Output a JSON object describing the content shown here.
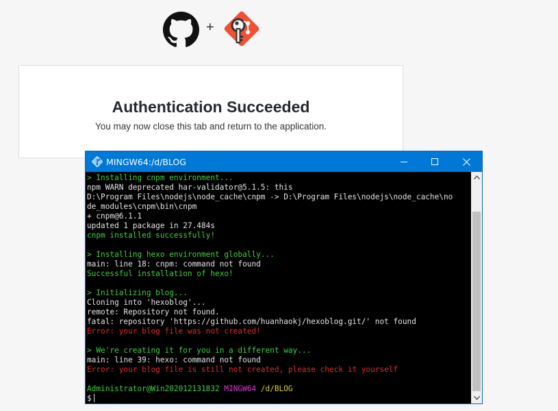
{
  "header": {
    "plus": "+",
    "github_logo_icon": "github-octocat-icon",
    "git_credential_manager_icon": "git-credential-manager-icon"
  },
  "auth": {
    "title": "Authentication Succeeded",
    "message": "You may now close this tab and return to the application."
  },
  "terminal": {
    "title": "MINGW64:/d/BLOG",
    "app_icon": "git-bash-icon",
    "controls": [
      "minimize-icon",
      "maximize-icon",
      "close-icon"
    ],
    "lines": [
      [
        {
          "t": "> Installing cnpm environment...",
          "c": "g"
        }
      ],
      [
        {
          "t": "npm WARN deprecated har-validator@5.1.5: this",
          "c": "w"
        }
      ],
      [
        {
          "t": "D:\\Program Files\\nodejs\\node_cache\\cnpm -> D:\\Program Files\\nodejs\\node_cache\\no",
          "c": "w"
        }
      ],
      [
        {
          "t": "de_modules\\cnpm\\bin\\cnpm",
          "c": "w"
        }
      ],
      [
        {
          "t": "+ cnpm@6.1.1",
          "c": "w"
        }
      ],
      [
        {
          "t": "updated 1 package in 27.484s",
          "c": "w"
        }
      ],
      [
        {
          "t": "cnpm installed successfully!",
          "c": "g"
        }
      ],
      [],
      [
        {
          "t": "> Installing hexo environment globally...",
          "c": "g"
        }
      ],
      [
        {
          "t": "main: line 18: cnpm: command not found",
          "c": "w"
        }
      ],
      [
        {
          "t": "Successful installation of hexo!",
          "c": "g"
        }
      ],
      [],
      [
        {
          "t": "> Initializing blog...",
          "c": "g"
        }
      ],
      [
        {
          "t": "Cloning into 'hexoblog'...",
          "c": "w"
        }
      ],
      [
        {
          "t": "remote: Repository not found.",
          "c": "w"
        }
      ],
      [
        {
          "t": "fatal: repository 'https://github.com/huanhaokj/hexoblog.git/' not found",
          "c": "w"
        }
      ],
      [
        {
          "t": "Error: your blog file was not created!",
          "c": "r"
        }
      ],
      [],
      [
        {
          "t": "> We're creating it for you in a different way...",
          "c": "g"
        }
      ],
      [
        {
          "t": "main: line 39: hexo: command not found",
          "c": "w"
        }
      ],
      [
        {
          "t": "Error: your blog file is still not created, please check it yourself",
          "c": "r"
        }
      ],
      [],
      [
        {
          "t": "Administrator@Win202012131832",
          "c": "g"
        },
        {
          "t": " ",
          "c": "w"
        },
        {
          "t": "MINGW64",
          "c": "m"
        },
        {
          "t": " ",
          "c": "w"
        },
        {
          "t": "/d/BLOG",
          "c": "y"
        }
      ],
      [
        {
          "t": "$",
          "c": "w"
        }
      ]
    ]
  },
  "colors": {
    "titlebar": "#0078d7",
    "console_bg": "#000000",
    "green": "#3fd13f",
    "red": "#e22a2a",
    "magenta": "#d63bd6",
    "yellow": "#d8d42a"
  }
}
